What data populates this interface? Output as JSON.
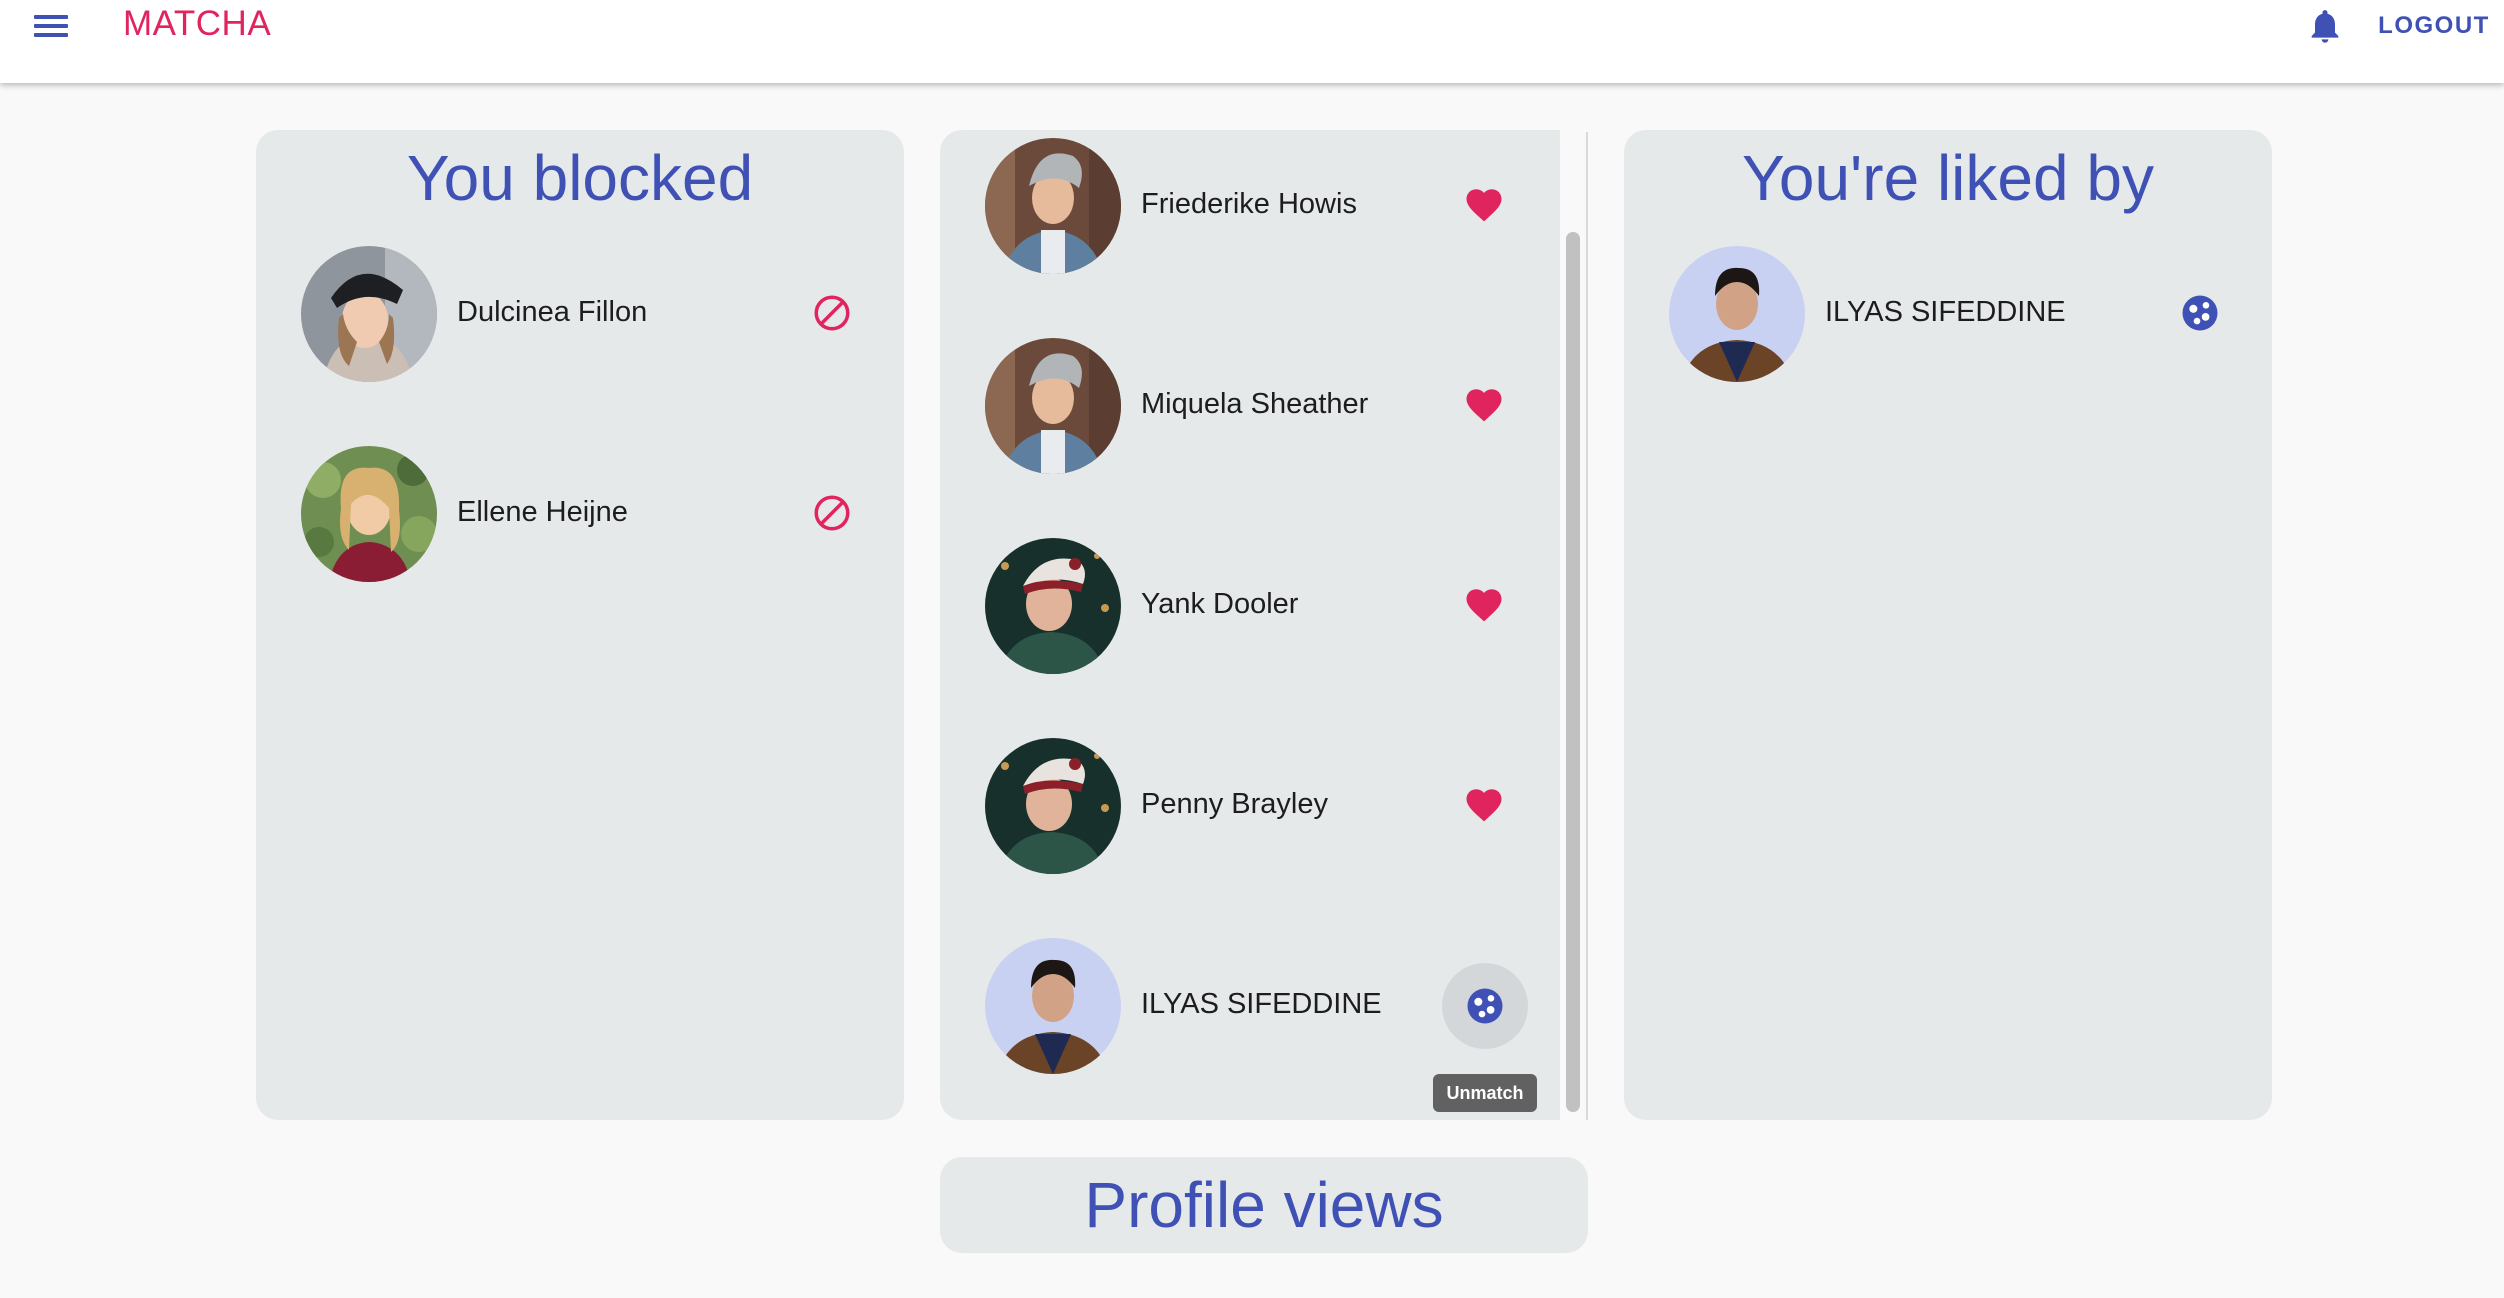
{
  "app": {
    "brand": "MATCHA",
    "logout_label": "LOGOUT",
    "icons": {
      "menu": "menu-icon",
      "bell": "bell-icon"
    },
    "colors": {
      "accent": "#3f51b5",
      "brand": "#e0245e",
      "panel": "#e6e9ea"
    }
  },
  "blocked": {
    "title": "You blocked",
    "users": [
      {
        "name": "Dulcinea Fillon",
        "action_icon": "block-icon"
      },
      {
        "name": "Ellene Heijne",
        "action_icon": "block-icon"
      }
    ]
  },
  "matches": {
    "users": [
      {
        "name": "Friederike Howis",
        "action_icon": "heart-icon"
      },
      {
        "name": "Miquela Sheather",
        "action_icon": "heart-icon"
      },
      {
        "name": "Yank Dooler",
        "action_icon": "heart-icon"
      },
      {
        "name": "Penny Brayley",
        "action_icon": "heart-icon"
      },
      {
        "name": "ILYAS SIFEDDINE",
        "action_icon": "unmatch-icon"
      }
    ],
    "tooltip": "Unmatch"
  },
  "liked_by": {
    "title": "You're liked by",
    "users": [
      {
        "name": "ILYAS SIFEDDINE",
        "action_icon": "match-icon"
      }
    ]
  },
  "profile_views": {
    "title": "Profile views"
  }
}
